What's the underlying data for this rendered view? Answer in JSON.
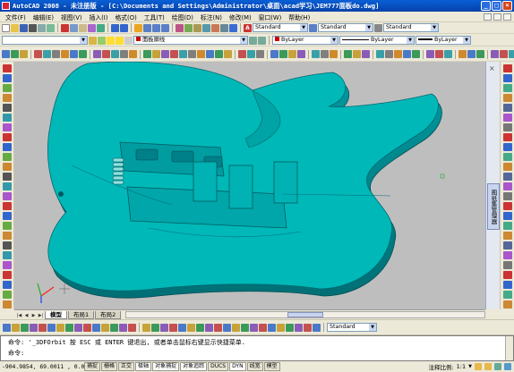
{
  "window": {
    "title": "AutoCAD 2008 - 未注册版 - [C:\\Documents and Settings\\Administrator\\桌面\\acad学习\\JEM777面板do.dwg]",
    "btn_minimize": "_",
    "btn_restore": "□",
    "btn_close": "×"
  },
  "menu": {
    "items": [
      "文件(F)",
      "编辑(E)",
      "视图(V)",
      "插入(I)",
      "格式(O)",
      "工具(T)",
      "绘图(D)",
      "标注(N)",
      "修改(M)",
      "窗口(W)",
      "帮助(H)"
    ]
  },
  "toolbar_props": {
    "text_style": "Standard",
    "dim_style": "Standard",
    "table_style": "Standard",
    "layer_name": "面板廓线",
    "color": "ByLayer",
    "linetype": "ByLayer",
    "lineweight": "ByLayer"
  },
  "layout_tabs": [
    "模型",
    "布局1",
    "布局2"
  ],
  "bottom_toolbar": {
    "style": "Standard"
  },
  "navigation_panel": {
    "label": "图纸集管理器"
  },
  "command": {
    "line1": "命令: '_3DFOrbit 按 ESC 或 ENTER 键退出, 或者单击鼠标右键显示快捷菜单.",
    "line2": "命令:"
  },
  "status": {
    "coordinates": "-904.9854, 69.0011 , 0.0000",
    "toggles": [
      "捕捉",
      "栅格",
      "正交",
      "极轴",
      "对象捕捉",
      "对象追踪",
      "DUCS",
      "DYN",
      "线宽",
      "模型"
    ],
    "toggles_on": [
      "极轴",
      "对象捕捉",
      "对象追踪",
      "DYN"
    ],
    "annotation_scale_label": "注释比例:",
    "annotation_scale": "1:1"
  },
  "colors": {
    "model_fill": "#00b8b8",
    "viewport_bg": "#bebebe",
    "titlebar": "#0a5fd6"
  }
}
